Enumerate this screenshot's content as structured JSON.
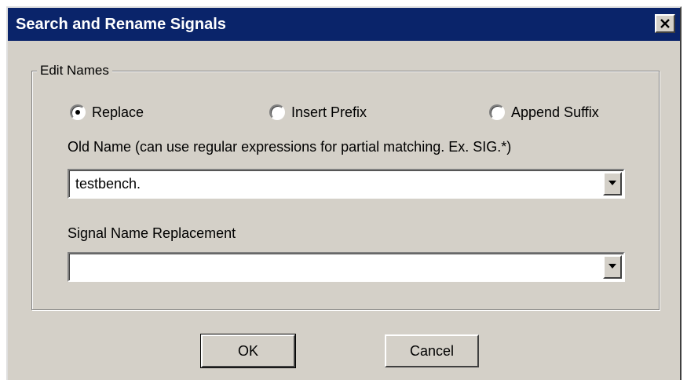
{
  "window": {
    "title": "Search and Rename Signals"
  },
  "group": {
    "legend": "Edit Names"
  },
  "mode_options": [
    {
      "label": "Replace",
      "selected": true
    },
    {
      "label": "Insert Prefix",
      "selected": false
    },
    {
      "label": "Append Suffix",
      "selected": false
    }
  ],
  "old_name": {
    "label": "Old Name (can use regular expressions for partial matching. Ex. SIG.*)",
    "value": "testbench."
  },
  "replacement": {
    "label": "Signal Name Replacement",
    "value": ""
  },
  "buttons": {
    "ok": "OK",
    "cancel": "Cancel"
  },
  "icons": {
    "close": "close-icon",
    "dropdown": "chevron-down-icon"
  },
  "colors": {
    "titlebar": "#0a246a",
    "face": "#d4d0c8"
  }
}
